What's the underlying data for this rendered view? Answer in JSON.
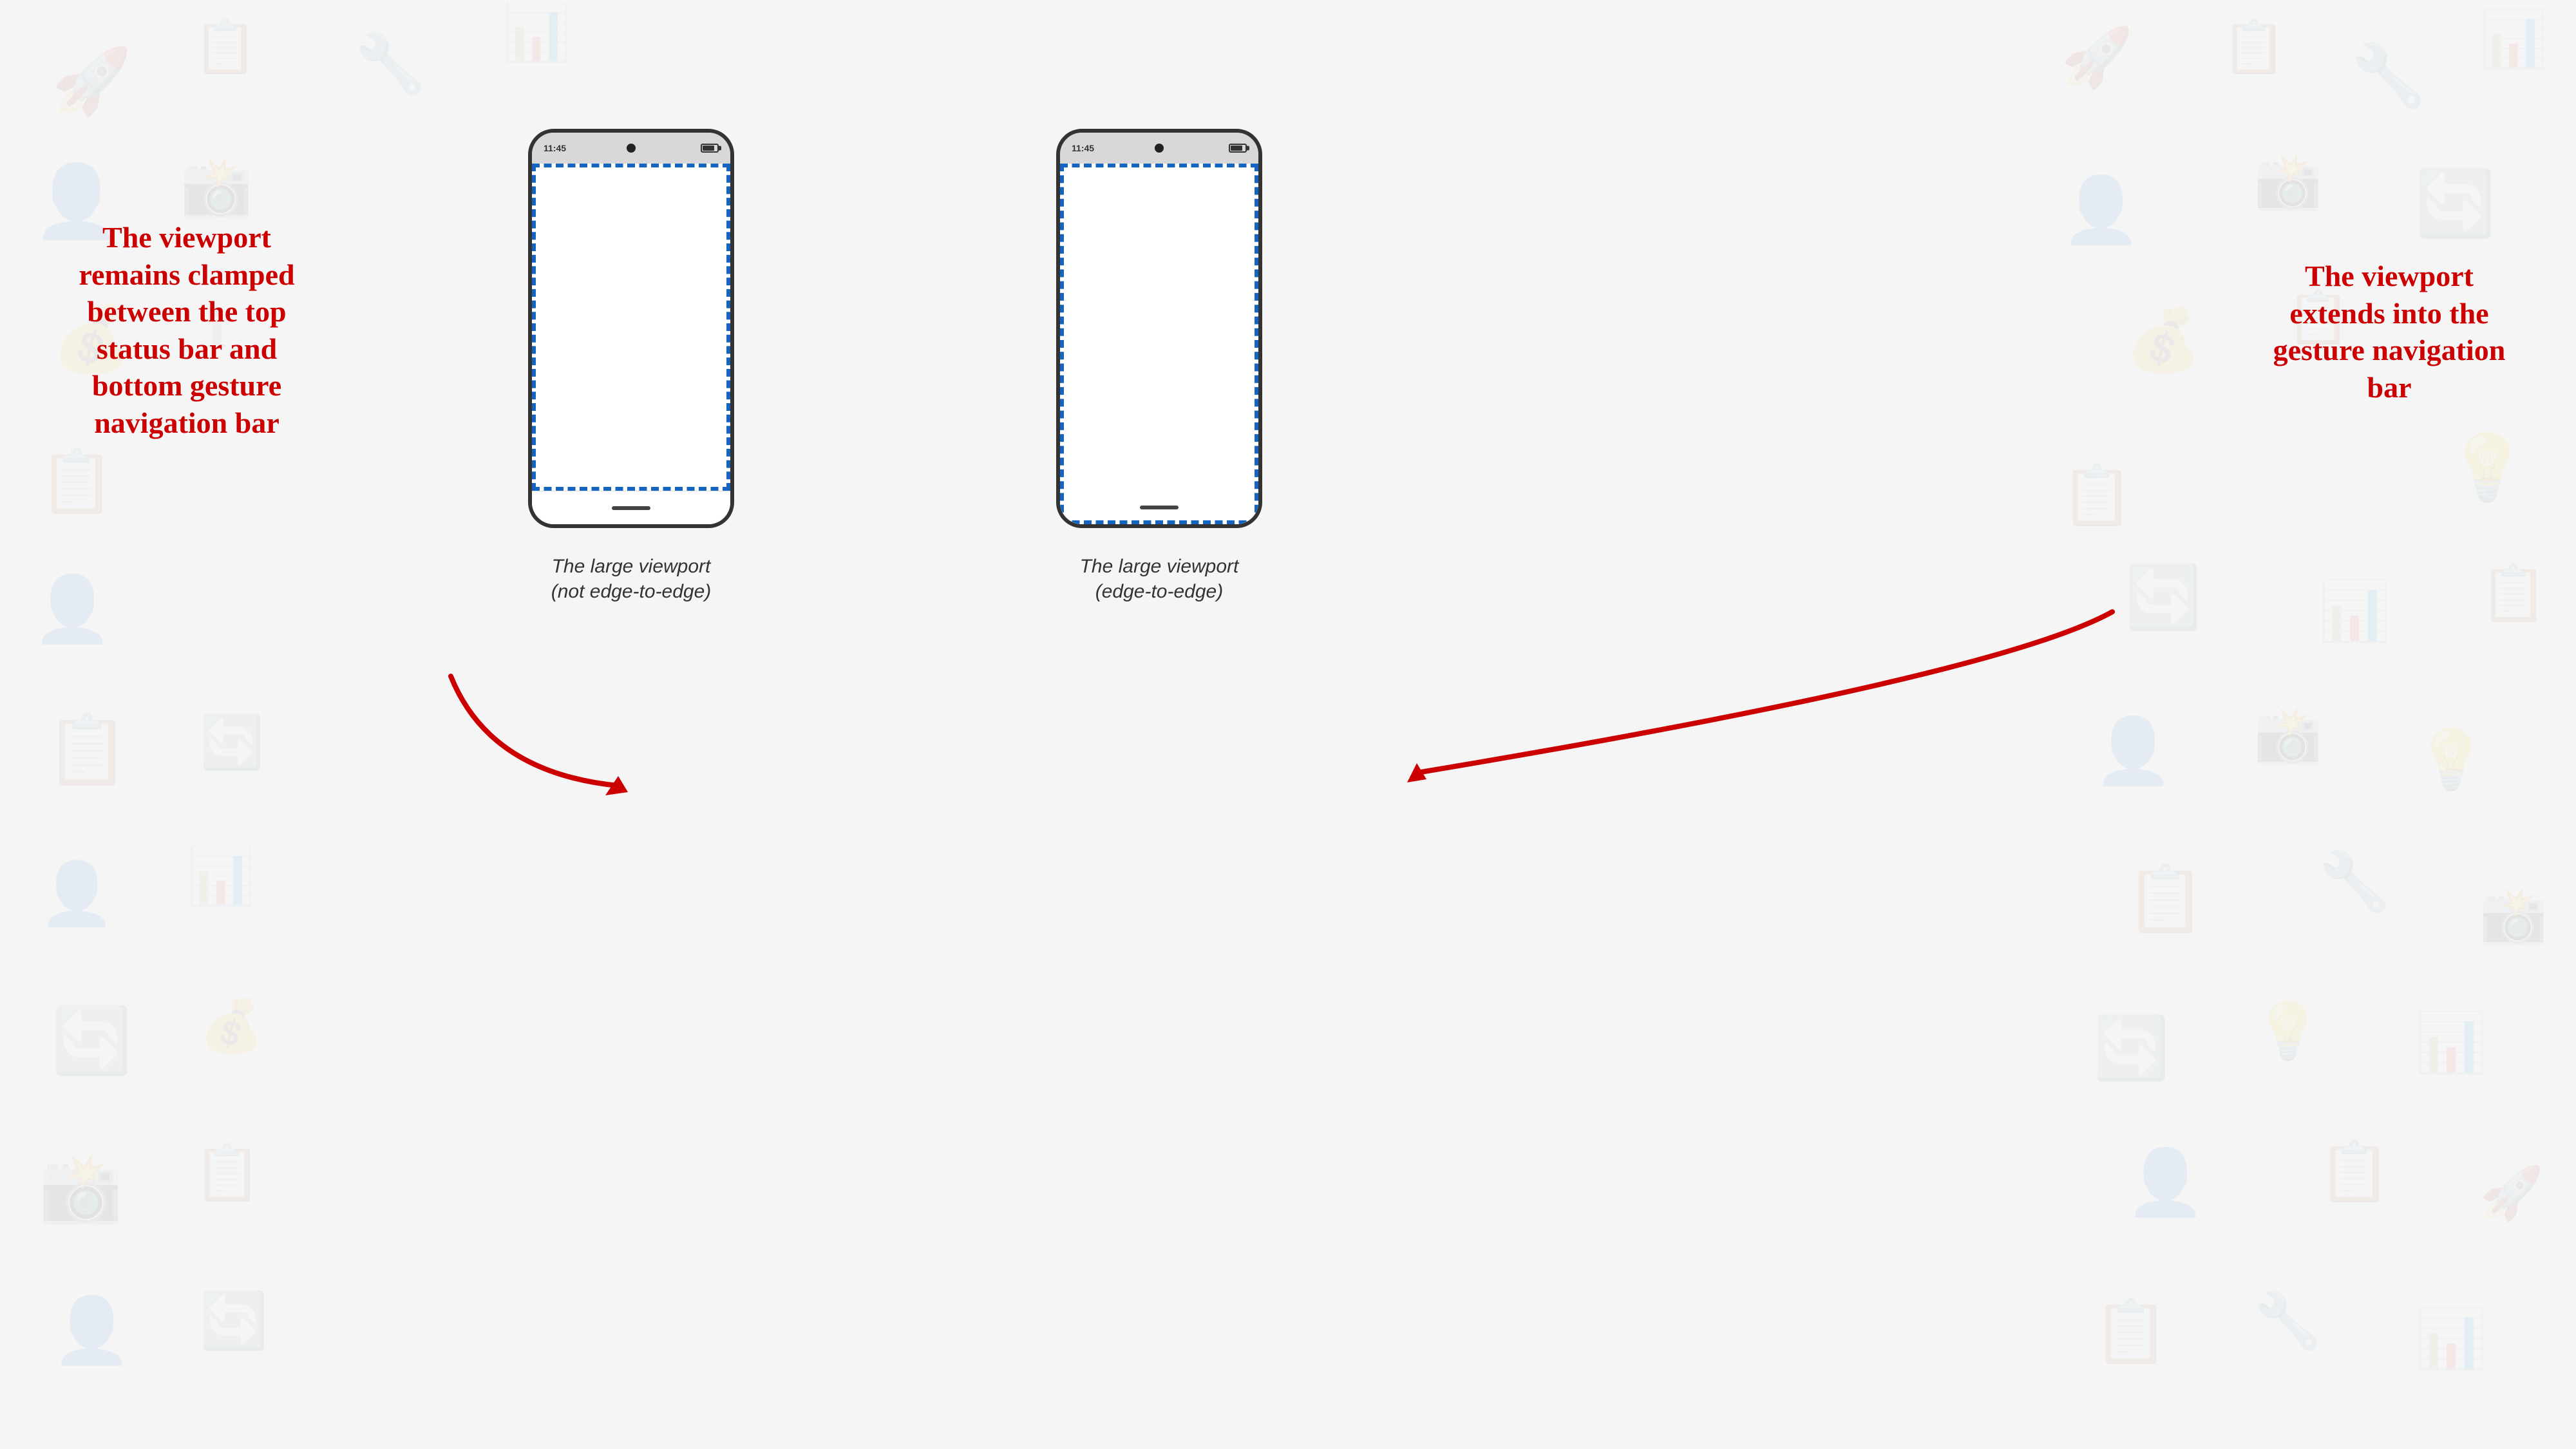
{
  "background": {
    "color": "#f0f0f0"
  },
  "phone_left": {
    "status_time": "11:45",
    "caption_line1": "The large viewport",
    "caption_line2": "(not edge-to-edge)"
  },
  "phone_right": {
    "status_time": "11:45",
    "caption_line1": "The large viewport",
    "caption_line2": "(edge-to-edge)"
  },
  "annotation_left": {
    "text": "The viewport remains clamped between the top status bar and bottom gesture navigation bar"
  },
  "annotation_right": {
    "text": "The viewport extends into the gesture navigation bar"
  }
}
